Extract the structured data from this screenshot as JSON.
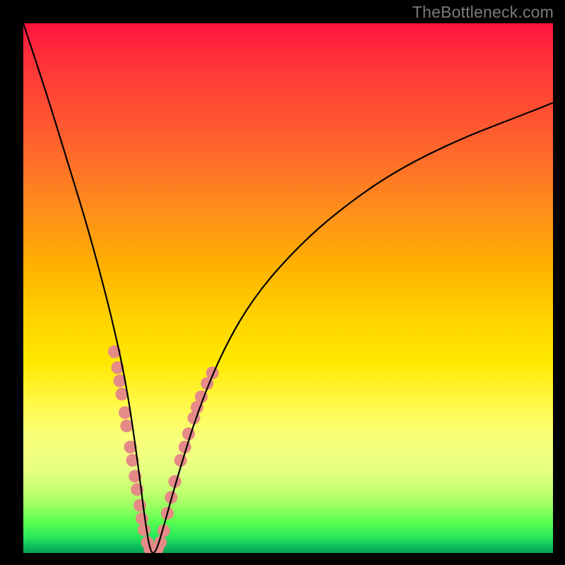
{
  "watermark": "TheBottleneck.com",
  "chart_data": {
    "type": "line",
    "title": "",
    "xlabel": "",
    "ylabel": "",
    "xlim": [
      0,
      100
    ],
    "ylim": [
      0,
      100
    ],
    "background_gradient": {
      "orientation": "vertical",
      "stops": [
        {
          "pos": 0,
          "color": "#ff143c"
        },
        {
          "pos": 20,
          "color": "#ff5a2f"
        },
        {
          "pos": 46,
          "color": "#ffb200"
        },
        {
          "pos": 72,
          "color": "#fff94a"
        },
        {
          "pos": 90,
          "color": "#9cff60"
        },
        {
          "pos": 100,
          "color": "#079e54"
        }
      ]
    },
    "series": [
      {
        "name": "bottleneck-curve",
        "stroke": "#000000",
        "x": [
          0,
          4,
          8,
          12,
          15,
          17,
          19,
          20.5,
          22,
          23,
          24,
          25,
          26.5,
          29,
          33,
          38,
          44,
          52,
          60,
          70,
          82,
          95,
          100
        ],
        "y": [
          100,
          88,
          75,
          62,
          51,
          43,
          34,
          25,
          14,
          6,
          0,
          0,
          5,
          14,
          27,
          39,
          49,
          58,
          65,
          72,
          78,
          83,
          85
        ]
      }
    ],
    "markers": {
      "name": "highlight-dots",
      "color": "#e58a87",
      "radius": 9,
      "points": [
        {
          "x": 17.2,
          "y": 38
        },
        {
          "x": 17.8,
          "y": 35
        },
        {
          "x": 18.2,
          "y": 32.5
        },
        {
          "x": 18.6,
          "y": 30
        },
        {
          "x": 19.2,
          "y": 26.5
        },
        {
          "x": 19.5,
          "y": 24
        },
        {
          "x": 20.2,
          "y": 20
        },
        {
          "x": 20.6,
          "y": 17.5
        },
        {
          "x": 21.1,
          "y": 14.5
        },
        {
          "x": 21.5,
          "y": 12
        },
        {
          "x": 22.0,
          "y": 9
        },
        {
          "x": 22.4,
          "y": 6.5
        },
        {
          "x": 22.8,
          "y": 4.4
        },
        {
          "x": 23.4,
          "y": 2.0
        },
        {
          "x": 23.9,
          "y": 0.8
        },
        {
          "x": 24.6,
          "y": 0.6
        },
        {
          "x": 25.3,
          "y": 0.8
        },
        {
          "x": 25.9,
          "y": 2.0
        },
        {
          "x": 26.5,
          "y": 4.2
        },
        {
          "x": 27.2,
          "y": 7.5
        },
        {
          "x": 27.9,
          "y": 10.5
        },
        {
          "x": 28.6,
          "y": 13.5
        },
        {
          "x": 29.7,
          "y": 17.5
        },
        {
          "x": 30.5,
          "y": 20
        },
        {
          "x": 31.2,
          "y": 22.5
        },
        {
          "x": 32.2,
          "y": 25.5
        },
        {
          "x": 32.8,
          "y": 27.5
        },
        {
          "x": 33.6,
          "y": 29.5
        },
        {
          "x": 34.7,
          "y": 32
        },
        {
          "x": 35.7,
          "y": 34
        }
      ]
    }
  }
}
